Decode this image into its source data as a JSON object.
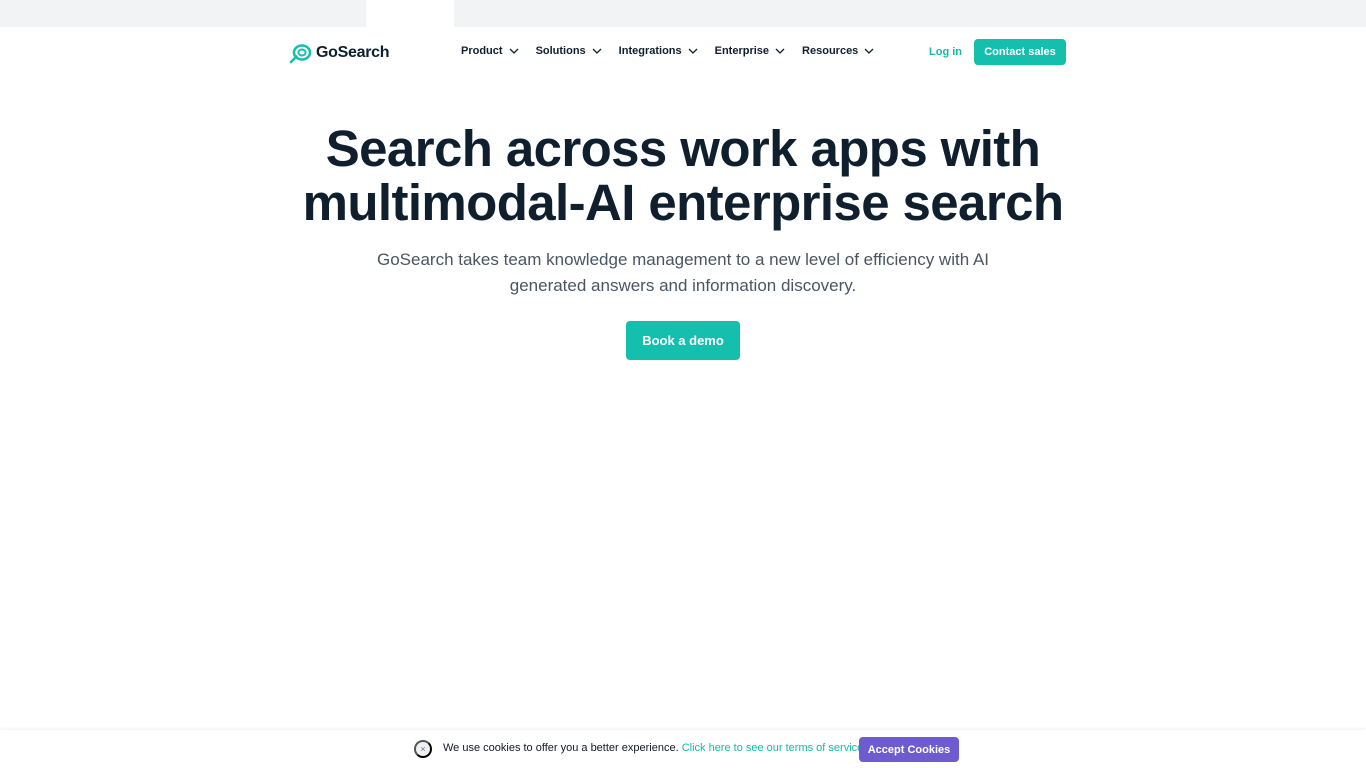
{
  "brand": {
    "name": "GoSearch",
    "accent_color": "#14bfae",
    "text_color": "#0f1f2e"
  },
  "nav": {
    "menu": [
      {
        "label": "Product",
        "icon": "chevron-down-icon"
      },
      {
        "label": "Solutions",
        "icon": "chevron-down-icon"
      },
      {
        "label": "Integrations",
        "icon": "chevron-down-icon"
      },
      {
        "label": "Enterprise",
        "icon": "chevron-down-icon"
      },
      {
        "label": "Resources",
        "icon": "chevron-down-icon"
      }
    ],
    "login_label": "Log in",
    "contact_label": "Contact sales"
  },
  "hero": {
    "title_line1": "Search across work apps with",
    "title_line2": "multimodal-AI enterprise search",
    "subtitle_line1": "GoSearch takes team knowledge management to a new level of efficiency with AI",
    "subtitle_line2": "generated answers and information discovery.",
    "cta_label": "Book a demo"
  },
  "cookie": {
    "close_symbol": "×",
    "message": "We use cookies to offer you a better experience.",
    "link_text": "Click here to see our terms of service.",
    "accept_label": "Accept Cookies",
    "accept_color": "#6e5bd0"
  }
}
